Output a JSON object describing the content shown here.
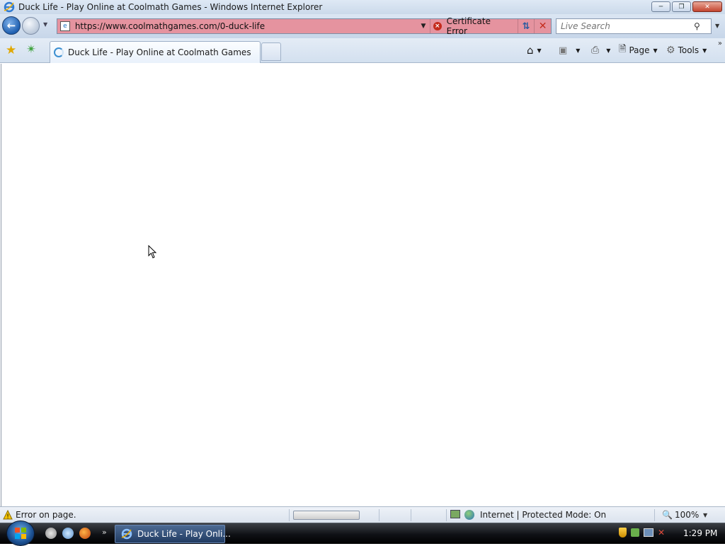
{
  "window": {
    "title": "Duck Life - Play Online at Coolmath Games - Windows Internet Explorer"
  },
  "navigation": {
    "url": "https://www.coolmathgames.com/0-duck-life",
    "certificate_error_label": "Certificate Error",
    "search_placeholder": "Live Search"
  },
  "tabs": [
    {
      "label": "Duck Life - Play Online at Coolmath Games",
      "active": true,
      "loading": true
    }
  ],
  "command_bar": {
    "page_label": "Page",
    "tools_label": "Tools"
  },
  "status_bar": {
    "status_text": "Error on page.",
    "zone_text": "Internet | Protected Mode: On",
    "zoom_label": "100%"
  },
  "taskbar": {
    "active_task_label": "Duck Life - Play Onli...",
    "clock": "1:29 PM"
  },
  "colors": {
    "address_bar_error": "#e5939f",
    "taskbar": "#0f1115",
    "accent": "#1f5fb0"
  },
  "icons": {
    "browser": "ie-icon",
    "back": "back-arrow-icon",
    "forward": "forward-arrow-icon",
    "favorites": "star-icon",
    "add_favorites": "add-favorites-icon",
    "home": "home-icon",
    "feeds": "rss-feed-icon",
    "print": "printer-icon",
    "page": "page-icon",
    "tools": "gear-icon",
    "search": "magnifier-icon",
    "warning": "warning-icon",
    "zoom": "zoom-icon"
  }
}
